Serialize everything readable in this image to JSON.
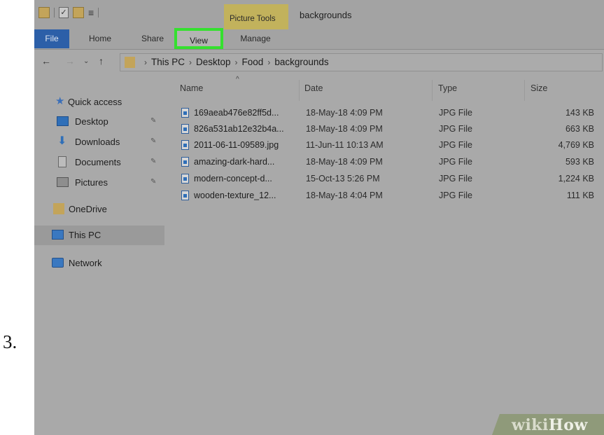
{
  "step_number": "3.",
  "window": {
    "title": "backgrounds",
    "contextual_group": "Picture Tools"
  },
  "ribbon": {
    "tabs": [
      {
        "label": "File"
      },
      {
        "label": "Home"
      },
      {
        "label": "Share"
      },
      {
        "label": "View",
        "highlighted": true
      },
      {
        "label": "Manage"
      }
    ],
    "highlight_color": "#35e02f",
    "file_tab_color": "#2c5fa8"
  },
  "address": {
    "crumbs": [
      "This PC",
      "Desktop",
      "Food",
      "backgrounds"
    ]
  },
  "nav_pane": {
    "quick_access": "Quick access",
    "items": [
      {
        "label": "Desktop",
        "icon": "desktop-icon",
        "pinned": true
      },
      {
        "label": "Downloads",
        "icon": "download-arrow-icon",
        "pinned": true
      },
      {
        "label": "Documents",
        "icon": "document-icon",
        "pinned": true
      },
      {
        "label": "Pictures",
        "icon": "pictures-icon",
        "pinned": true
      }
    ],
    "onedrive": "OneDrive",
    "this_pc": "This PC",
    "network": "Network"
  },
  "file_list": {
    "columns": [
      "Name",
      "Date",
      "Type",
      "Size"
    ],
    "rows": [
      {
        "name": "169aeab476e82ff5d...",
        "date": "18-May-18 4:09 PM",
        "type": "JPG File",
        "size": "143 KB"
      },
      {
        "name": "826a531ab12e32b4a...",
        "date": "18-May-18 4:09 PM",
        "type": "JPG File",
        "size": "663 KB"
      },
      {
        "name": "2011-06-11-09589.jpg",
        "date": "11-Jun-11 10:13 AM",
        "type": "JPG File",
        "size": "4,769 KB"
      },
      {
        "name": "amazing-dark-hard...",
        "date": "18-May-18 4:09 PM",
        "type": "JPG File",
        "size": "593 KB"
      },
      {
        "name": "modern-concept-d...",
        "date": "15-Oct-13 5:26 PM",
        "type": "JPG File",
        "size": "1,224 KB"
      },
      {
        "name": "wooden-texture_12...",
        "date": "18-May-18 4:04 PM",
        "type": "JPG File",
        "size": "111 KB"
      }
    ]
  },
  "watermark": {
    "part1": "wiki",
    "part2": "How"
  }
}
